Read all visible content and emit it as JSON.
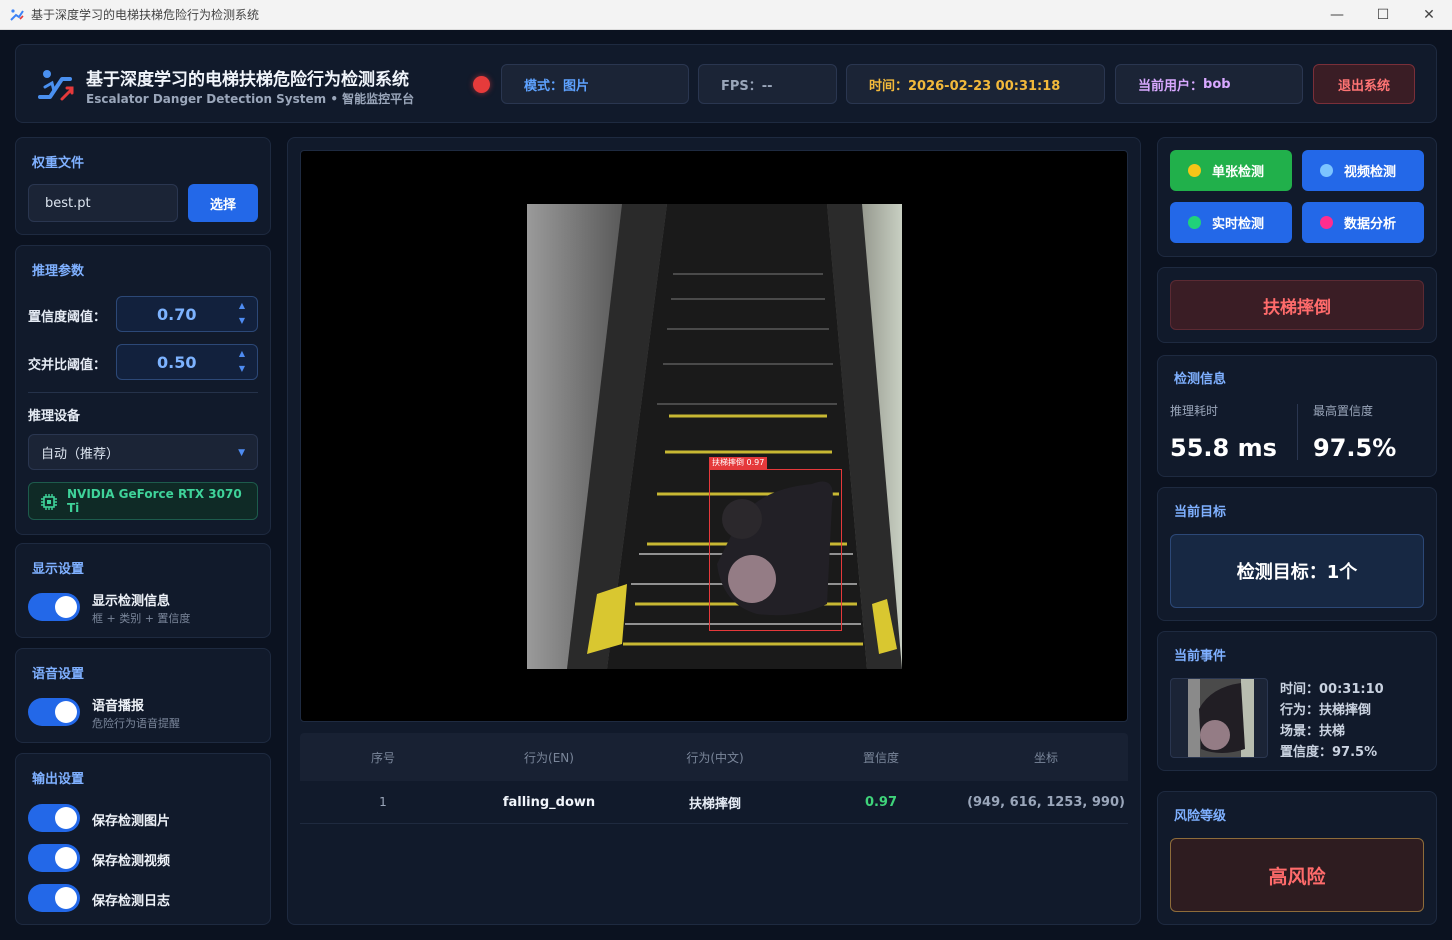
{
  "window": {
    "title": "基于深度学习的电梯扶梯危险行为检测系统",
    "controls": {
      "minimize": "—",
      "maximize": "☐",
      "close": "✕"
    }
  },
  "header": {
    "title": "基于深度学习的电梯扶梯危险行为检测系统",
    "subtitle": "Escalator Danger Detection System • 智能监控平台",
    "mode": "模式：图片",
    "fps": "FPS：--",
    "time": "时间：2026-02-23 00:31:18",
    "user_prefix": "当前用户：",
    "user_name": "bob",
    "logout_label": "退出系统"
  },
  "weights": {
    "title": "权重文件",
    "file_value": "best.pt",
    "select_label": "选择"
  },
  "inference": {
    "title": "推理参数",
    "conf_label": "置信度阈值：",
    "conf_value": "0.70",
    "iou_label": "交并比阈值：",
    "iou_value": "0.50",
    "device_title": "推理设备",
    "device_value": "自动（推荐）",
    "gpu_name": "NVIDIA GeForce RTX 3070 Ti"
  },
  "display": {
    "title": "显示设置",
    "show_info_label": "显示检测信息",
    "show_info_sub": "框 + 类别 + 置信度",
    "show_info_on": true
  },
  "voice": {
    "title": "语音设置",
    "broadcast_label": "语音播报",
    "broadcast_sub": "危险行为语音提醒",
    "broadcast_on": true
  },
  "output": {
    "title": "输出设置",
    "items": [
      {
        "label": "保存检测图片",
        "on": true
      },
      {
        "label": "保存检测视频",
        "on": true
      },
      {
        "label": "保存检测日志",
        "on": true
      }
    ]
  },
  "viewer": {
    "bbox_label": "扶梯摔倒 0.97"
  },
  "results_table": {
    "headers": [
      "序号",
      "行为(EN)",
      "行为(中文)",
      "置信度",
      "坐标"
    ],
    "rows": [
      [
        "1",
        "falling_down",
        "扶梯摔倒",
        "0.97",
        "(949, 616, 1253, 990)"
      ]
    ]
  },
  "detect_modes": {
    "single": {
      "label": "单张检测",
      "color": "#21b04b",
      "dot": "#f5c518"
    },
    "video": {
      "label": "视频检测",
      "color": "#2368e8",
      "dot": "#7cc4ff"
    },
    "realtime": {
      "label": "实时检测",
      "color": "#2368e8",
      "dot": "#20d27a"
    },
    "analysis": {
      "label": "数据分析",
      "color": "#2368e8",
      "dot": "#ff2d8e"
    }
  },
  "alert": {
    "text": "扶梯摔倒"
  },
  "detect_info": {
    "title": "检测信息",
    "time_label": "推理耗时",
    "time_value": "55.8 ms",
    "conf_label": "最高置信度",
    "conf_value": "97.5%"
  },
  "current_target": {
    "title": "当前目标",
    "text": "检测目标：1个"
  },
  "current_event": {
    "title": "当前事件",
    "time": "时间：00:31:10",
    "behavior": "行为：扶梯摔倒",
    "scene": "场景：扶梯",
    "confidence": "置信度：97.5%"
  },
  "risk": {
    "title": "风险等级",
    "level": "高风险"
  }
}
